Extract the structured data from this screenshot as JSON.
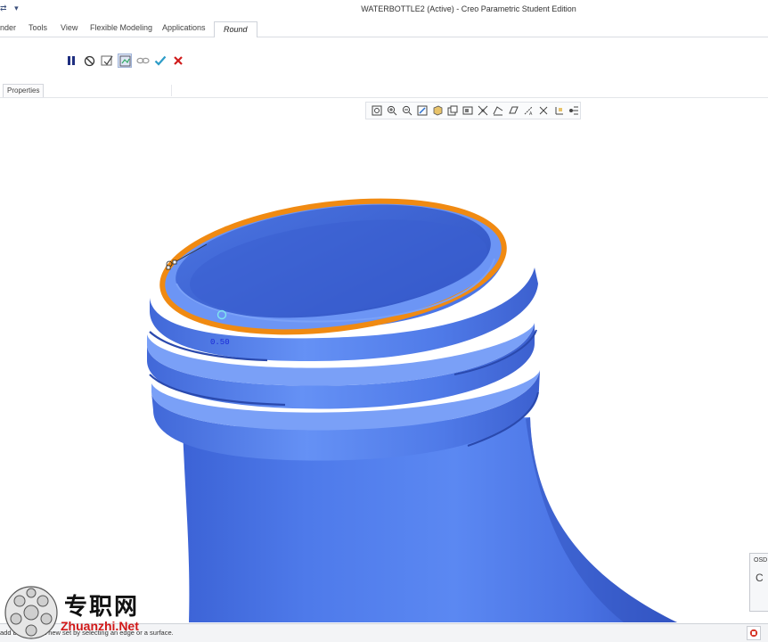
{
  "window": {
    "title": "WATERBOTTLE2 (Active) - Creo Parametric Student Edition",
    "qa_icon_a": "⇄",
    "qa_icon_b": "▾"
  },
  "ribbon": {
    "tabs": [
      {
        "label": "nder"
      },
      {
        "label": "Tools"
      },
      {
        "label": "View"
      },
      {
        "label": "Flexible Modeling"
      },
      {
        "label": "Applications"
      },
      {
        "label": "Round"
      }
    ],
    "active_tab": "Round"
  },
  "dashboard": {
    "icons": [
      "pause-icon",
      "no-geometry-icon",
      "verify-icon",
      "preview-icon",
      "chain-icon",
      "ok-check-icon",
      "cancel-x-icon"
    ]
  },
  "panel_tabs": {
    "properties": "Properties"
  },
  "graphics_toolbar": {
    "icons": [
      "refit-icon",
      "zoom-in-icon",
      "zoom-out-icon",
      "repaint-icon",
      "display-style-icon",
      "saved-views-icon",
      "view-manager-icon",
      "datum-display-icon",
      "annotation-display-icon",
      "plane-tag-icon",
      "axis-tag-icon",
      "point-tag-icon",
      "csys-tag-icon",
      "spin-center-icon"
    ]
  },
  "viewport": {
    "dimension_value": "0.50"
  },
  "osd": {
    "title": "OSD",
    "body": "C"
  },
  "status": {
    "message": "add b         created a new set by selecting an edge or a surface."
  },
  "watermark": {
    "cn": "专职网",
    "en": "Zhuanzhi.Net"
  },
  "colors": {
    "model_blue": "#4f7ae8",
    "highlight_orange": "#f08a12",
    "accent_dark_blue": "#1f2f80"
  }
}
